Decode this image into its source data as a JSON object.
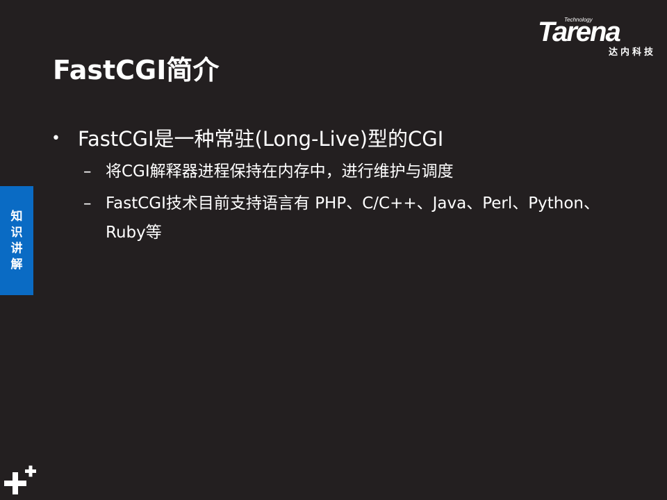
{
  "logo": {
    "small_text": "Technology",
    "brand": "Tarena",
    "subtitle": "达内科技"
  },
  "slide": {
    "title": "FastCGI简介",
    "section_tab": [
      "知",
      "识",
      "讲",
      "解"
    ],
    "bullet": {
      "marker": "•",
      "text": "FastCGI是一种常驻(Long-Live)型的CGI"
    },
    "sub_items": [
      {
        "marker": "–",
        "text": "将CGI解释器进程保持在内存中，进行维护与调度"
      },
      {
        "marker": "–",
        "text": "FastCGI技术目前支持语言有 PHP、C/C++、Java、Perl、Python、Ruby等"
      }
    ]
  },
  "colors": {
    "background": "#231f20",
    "tab_blue": "#0a6bc4",
    "text": "#ffffff"
  }
}
